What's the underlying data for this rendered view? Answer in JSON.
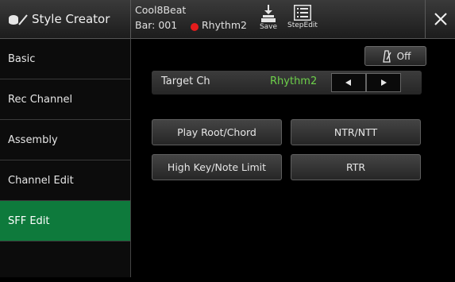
{
  "header": {
    "app_title": "Style Creator",
    "style_name": "Cool8Beat",
    "bar": "Bar: 001",
    "rec_target": "Rhythm2",
    "save_label": "Save",
    "stepedit_label": "StepEdit"
  },
  "sidebar": {
    "items": [
      {
        "label": "Basic"
      },
      {
        "label": "Rec Channel"
      },
      {
        "label": "Assembly"
      },
      {
        "label": "Channel Edit"
      },
      {
        "label": "SFF Edit"
      },
      {
        "label": ""
      }
    ],
    "active_index": 4
  },
  "main": {
    "metronome_state": "Off",
    "target_ch_label": "Target Ch",
    "target_ch_value": "Rhythm2",
    "buttons": {
      "play_root_chord": "Play Root/Chord",
      "ntr_ntt": "NTR/NTT",
      "high_key_note_limit": "High Key/Note Limit",
      "rtr": "RTR"
    }
  },
  "colors": {
    "active_tab": "#0e7a3c",
    "value_green": "#6dd04a",
    "record_red": "#e51c1c"
  }
}
